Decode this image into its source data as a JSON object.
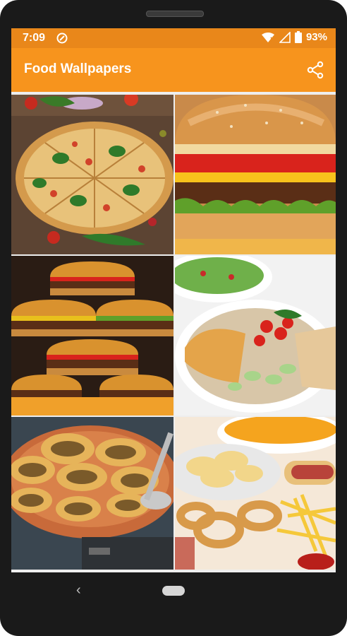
{
  "status_bar": {
    "time": "7:09",
    "battery_percent": "93%",
    "icons": [
      "notification-icon",
      "wifi-icon",
      "signal-icon",
      "battery-icon"
    ]
  },
  "app_bar": {
    "title": "Food Wallpapers",
    "action_icon": "share-icon",
    "colors": {
      "app_bar": "#f7941d",
      "status_bar": "#e9871a"
    }
  },
  "wallpapers": [
    {
      "subject": "pizza"
    },
    {
      "subject": "burger"
    },
    {
      "subject": "burgers-stack"
    },
    {
      "subject": "salad-bowl"
    },
    {
      "subject": "pani-puri"
    },
    {
      "subject": "snacks-chips-onion-rings"
    }
  ],
  "navigation": {
    "back_icon": "back-icon",
    "home_icon": "home-pill-icon"
  }
}
